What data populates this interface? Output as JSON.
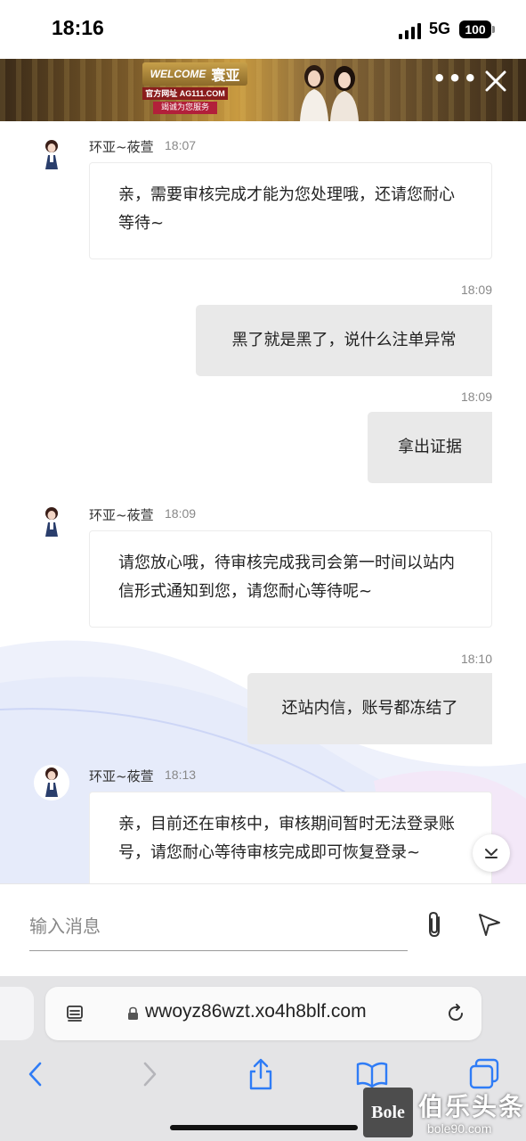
{
  "status_bar": {
    "time": "18:16",
    "network": "5G",
    "battery": "100"
  },
  "banner": {
    "welcome": "WELCOME",
    "brand": "寰亚",
    "site_label": "官方网址 AG111.COM",
    "slogan": "竭诚为您服务"
  },
  "chat": {
    "messages": [
      {
        "sender": "环亚~莜萱",
        "time": "18:07",
        "text": "亲，需要审核完成才能为您处理哦，还请您耐心等待~",
        "direction": "in"
      },
      {
        "time": "18:09",
        "text": "黑了就是黑了，说什么注单异常",
        "direction": "out"
      },
      {
        "time": "18:09",
        "text": "拿出证据",
        "direction": "out"
      },
      {
        "sender": "环亚~莜萱",
        "time": "18:09",
        "text": "请您放心哦，待审核完成我司会第一时间以站内信形式通知到您，请您耐心等待呢~",
        "direction": "in"
      },
      {
        "time": "18:10",
        "text": "还站内信，账号都冻结了",
        "direction": "out"
      },
      {
        "sender": "环亚~莜萱",
        "time": "18:13",
        "text": "亲，目前还在审核中，审核期间暂时无法登录账号，请您耐心等待审核完成即可恢复登录~",
        "direction": "in"
      }
    ]
  },
  "composer": {
    "placeholder": "输入消息"
  },
  "browser": {
    "url": "wwoyz86wzt.xo4h8blf.com"
  },
  "watermark": {
    "logo": "Bole",
    "title": "伯乐头条",
    "url": "bole90.com"
  },
  "colors": {
    "bubble_out": "#e9e9e9",
    "banner_gold": "#c89a40",
    "browser_chrome": "#e4e4e6",
    "ios_blue": "#2f7cf6"
  },
  "icons": [
    "dots-menu-icon",
    "close-icon",
    "paperclip-icon",
    "send-icon",
    "chevron-down-icon",
    "reader-icon",
    "lock-icon",
    "reload-icon",
    "back-icon",
    "forward-icon",
    "share-icon",
    "bookmarks-icon",
    "tabs-icon"
  ]
}
